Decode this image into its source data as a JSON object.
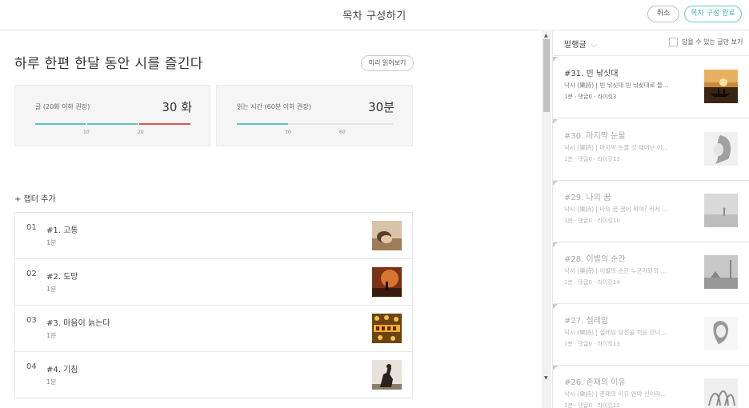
{
  "header": {
    "title": "목차 구성하기",
    "cancel_label": "취소",
    "done_label": "목차 구성 완료"
  },
  "book": {
    "title": "하루 한편 한달 동안 시를 즐긴다",
    "preview_label": "미리 읽어보기"
  },
  "stats": {
    "posts": {
      "label": "글 (20화 이하 권장)",
      "value": "30 화",
      "progress": 1.0,
      "ticks": [
        "10",
        "20"
      ],
      "colors": [
        "#5cc6c0",
        "#5cc6c0",
        "#e05555"
      ]
    },
    "reading": {
      "label": "읽는 시간 (60분 이하 권장)",
      "value": "30분",
      "progress": 0.33,
      "ticks": [
        "30",
        "60"
      ],
      "color": "#5cc6c0"
    }
  },
  "chapters": {
    "add_label": "+ 챕터 추가",
    "items": [
      {
        "num": "01",
        "title": "#1. 고통",
        "time": "1분",
        "thumb": "pain-photo"
      },
      {
        "num": "02",
        "title": "#2. 도망",
        "time": "1분",
        "thumb": "escape-photo"
      },
      {
        "num": "03",
        "title": "#3. 마음이 늙는다",
        "time": "1분",
        "thumb": "jackpot-photo"
      },
      {
        "num": "04",
        "title": "#4. 기침",
        "time": "1분",
        "thumb": "cough-photo"
      }
    ]
  },
  "scrollbar": {
    "up": "▲",
    "down": "▼"
  },
  "posts_panel": {
    "sort_label": "발행글",
    "sort_chevron": "⌵",
    "filter_label": "담을 수 있는 글만 보기",
    "items": [
      {
        "title": "#31. 빈 낚싯대",
        "desc": "낙시 (樂詩) | 빈 낚싯대 빈 낚싯대로 들…",
        "meta": "1분 · 댓글0 · 라이킷3",
        "active": true
      },
      {
        "title": "#30. 마지막 눈물",
        "desc": "낙시 (樂詩) | 마지막 눈물 것 태어난 아…",
        "meta": "1분 · 댓글0 · 라이킷13",
        "active": false
      },
      {
        "title": "#29. 나의 꿈",
        "desc": "낙시 (樂詩) | 나의 꿈 꿈이 뭐야? 커서 …",
        "meta": "1분 · 댓글0 · 라이킷10",
        "active": false
      },
      {
        "title": "#28. 이별의 순간",
        "desc": "낙시 (樂詩) | 이별의 순간 누군가와의 …",
        "meta": "1분 · 댓글0 · 라이킷14",
        "active": false
      },
      {
        "title": "#27. 설레임",
        "desc": "낙시 (樂詩) | 설레임 당신을 처음 만나…",
        "meta": "1분 · 댓글0 · 라이킷13",
        "active": false
      },
      {
        "title": "#26. 존재의 이유",
        "desc": "낙시 (樂詩) | 존재의 이유 만약 신이라…",
        "meta": "1분 · 댓글0 · 라이킷12",
        "active": false
      }
    ]
  }
}
